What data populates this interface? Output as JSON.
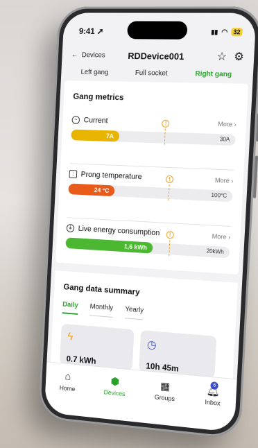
{
  "status": {
    "time": "9:41",
    "battery": "32"
  },
  "header": {
    "back_label": "Devices",
    "title": "RDDevice001"
  },
  "tabs": [
    {
      "label": "Left gang",
      "active": false
    },
    {
      "label": "Full socket",
      "active": false
    },
    {
      "label": "Right gang",
      "active": true
    }
  ],
  "metrics": {
    "title": "Gang metrics",
    "items": [
      {
        "label": "Current",
        "more": "More",
        "value": "7A",
        "max": "30A",
        "level": 0.3,
        "threshold": 0.58,
        "color": "#e8b400"
      },
      {
        "label": "Prong temperature",
        "more": "More",
        "value": "24 °C",
        "max": "100°C",
        "level": 0.24,
        "threshold": 0.62,
        "color": "#e85b1a"
      },
      {
        "label": "Live energy consumption",
        "more": "More",
        "value": "1,6 kWh",
        "max": "20kWh",
        "level": 0.54,
        "threshold": 0.64,
        "color": "#4cb832"
      }
    ]
  },
  "summary": {
    "title": "Gang data summary",
    "tabs": [
      {
        "label": "Daily",
        "active": true
      },
      {
        "label": "Monthly",
        "active": false
      },
      {
        "label": "Yearly",
        "active": false
      }
    ],
    "tiles": [
      {
        "icon": "lightning-icon",
        "value": "0.7 kWh"
      },
      {
        "icon": "clock-icon",
        "value": "10h 45m"
      }
    ]
  },
  "nav": [
    {
      "label": "Home",
      "icon": "home-icon",
      "active": false
    },
    {
      "label": "Devices",
      "icon": "devices-icon",
      "active": true
    },
    {
      "label": "Groups",
      "icon": "groups-icon",
      "active": false
    },
    {
      "label": "Inbox",
      "icon": "bell-icon",
      "active": false,
      "badge": "6"
    }
  ],
  "colors": {
    "accent": "#2aa02a",
    "warning": "#f0a020"
  }
}
